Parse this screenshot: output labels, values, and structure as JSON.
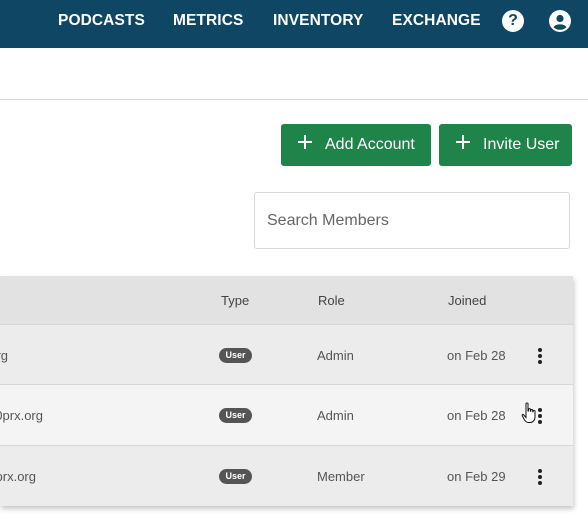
{
  "nav": {
    "links": [
      "PODCASTS",
      "METRICS",
      "INVENTORY",
      "EXCHANGE"
    ],
    "help_icon": "question-circle-icon",
    "account_icon": "user-circle-icon"
  },
  "actions": {
    "add_account": "Add Account",
    "invite_user": "Invite User",
    "icon": "plus-icon"
  },
  "search": {
    "placeholder": "Search Members",
    "value": ""
  },
  "table": {
    "columns": [
      "Type",
      "Role",
      "Joined"
    ],
    "rows": [
      {
        "email": "rg",
        "type": "User",
        "role": "Admin",
        "joined": "on Feb 28"
      },
      {
        "email": "0prx.org",
        "type": "User",
        "role": "Admin",
        "joined": "on Feb 28"
      },
      {
        "email": "prx.org",
        "type": "User",
        "role": "Member",
        "joined": "on Feb 29"
      }
    ],
    "row_menu_icon": "more-vertical-icon"
  },
  "colors": {
    "nav_bg": "#0f4663",
    "button_green": "#1e8449",
    "header_bg": "#e2e2e2",
    "badge_bg": "#555555"
  }
}
